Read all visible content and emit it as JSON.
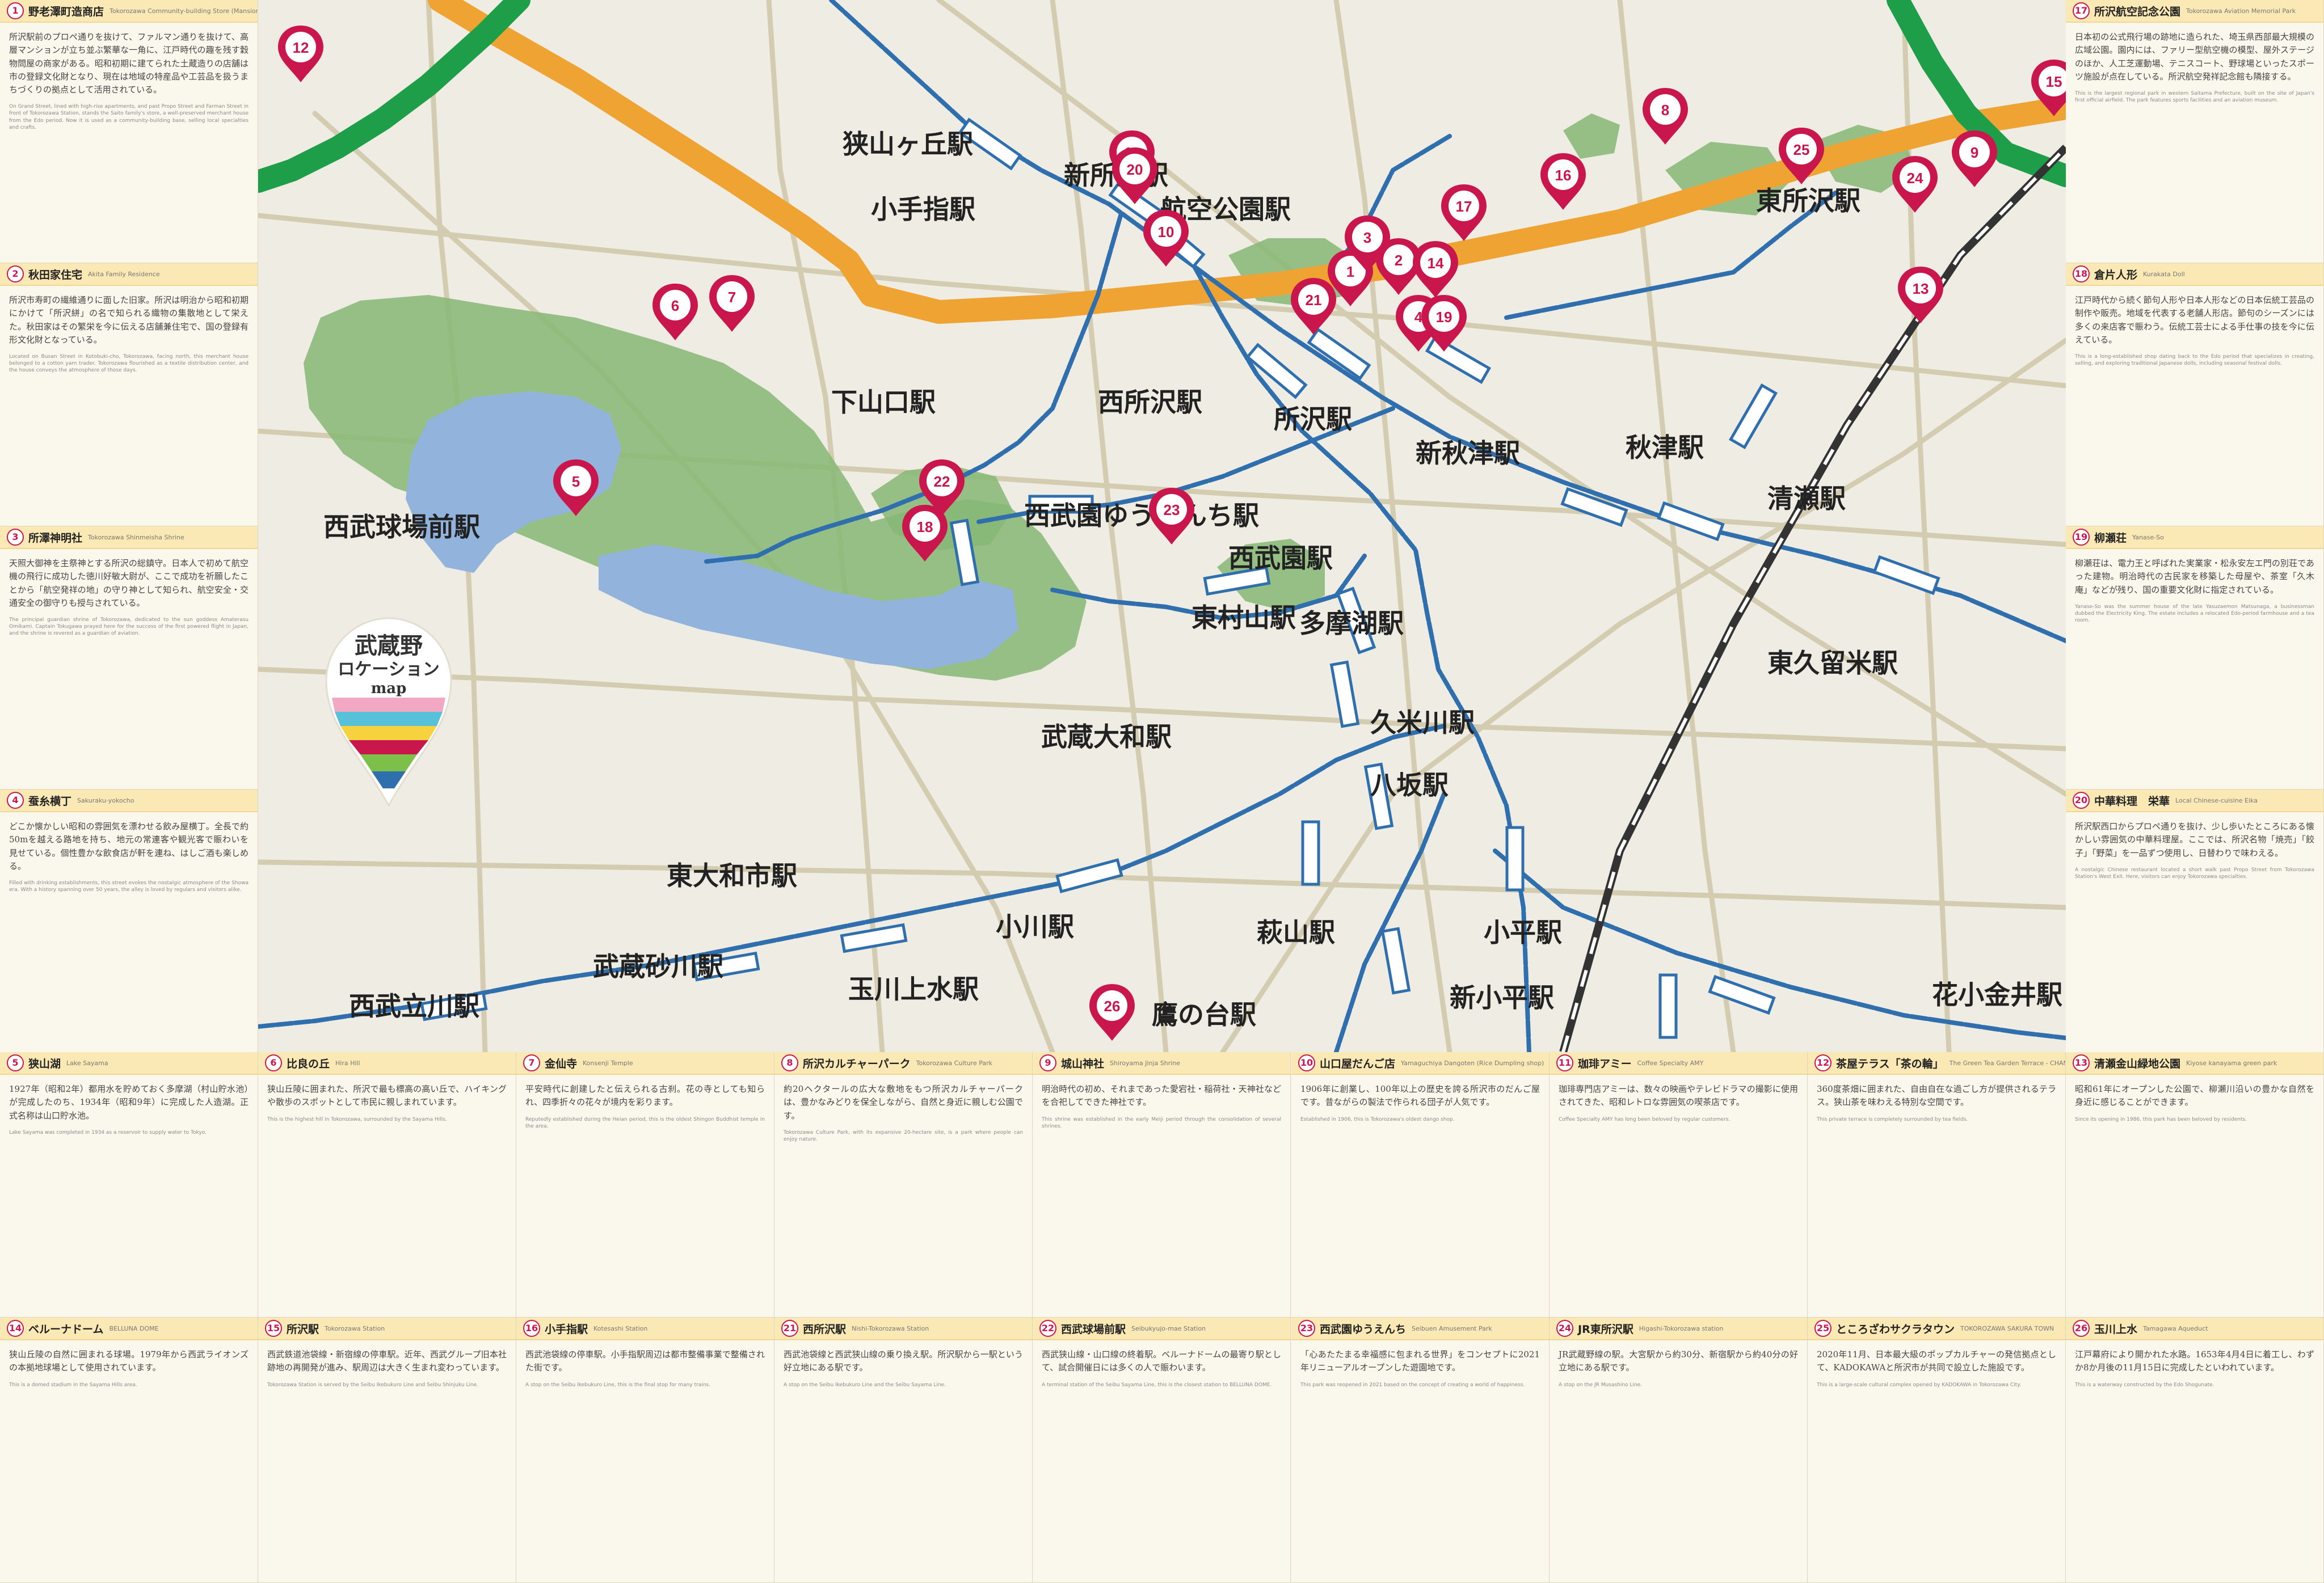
{
  "map": {
    "logo": {
      "line1": "武蔵野",
      "line2": "ロケーション",
      "line3": "map"
    },
    "stations": [
      {
        "label": "狭山ヶ丘駅"
      },
      {
        "label": "新所沢駅"
      },
      {
        "label": "小手指駅"
      },
      {
        "label": "航空公園駅"
      },
      {
        "label": "東所沢駅"
      },
      {
        "label": "下山口駅"
      },
      {
        "label": "西所沢駅"
      },
      {
        "label": "所沢駅"
      },
      {
        "label": "新秋津駅"
      },
      {
        "label": "秋津駅"
      },
      {
        "label": "清瀬駅"
      },
      {
        "label": "西武球場前駅"
      },
      {
        "label": "西武園ゆうえんち駅"
      },
      {
        "label": "西武園駅"
      },
      {
        "label": "多摩湖駅"
      },
      {
        "label": "東村山駅"
      },
      {
        "label": "東久留米駅"
      },
      {
        "label": "武蔵大和駅"
      },
      {
        "label": "久米川駅"
      },
      {
        "label": "八坂駅"
      },
      {
        "label": "東大和市駅"
      },
      {
        "label": "小川駅"
      },
      {
        "label": "萩山駅"
      },
      {
        "label": "小平駅"
      },
      {
        "label": "武蔵砂川駅"
      },
      {
        "label": "西武立川駅"
      },
      {
        "label": "玉川上水駅"
      },
      {
        "label": "新小平駅"
      },
      {
        "label": "鷹の台駅"
      },
      {
        "label": "花小金井駅"
      }
    ],
    "pins": [
      "1",
      "2",
      "3",
      "4",
      "5",
      "6",
      "7",
      "8",
      "9",
      "10",
      "11",
      "12",
      "13",
      "14",
      "15",
      "16",
      "17",
      "18",
      "19",
      "20",
      "21",
      "22",
      "23",
      "24",
      "25",
      "26"
    ]
  },
  "left_panels": [
    {
      "num": "1",
      "title": "野老澤町造商店",
      "en": "Tokorozawa Community-building Store (Mansion)",
      "jp": "所沢駅前のプロペ通りを抜けて、ファルマン通りを抜けて、高層マンションが立ち並ぶ繁華な一角に、江戸時代の趣を残す穀物問屋の商家がある。昭和初期に建てられた土蔵造りの店舗は市の登録文化財となり、現在は地域の特産品や工芸品を扱うまちづくりの拠点として活用されている。",
      "en_body": "On Grand Street, lined with high-rise apartments, and past Propo Street and Farman Street in front of Tokorozawa Station, stands the Saito family's store, a well-preserved merchant house from the Edo period. Now it is used as a community-building base, selling local specialties and crafts."
    },
    {
      "num": "2",
      "title": "秋田家住宅",
      "en": "Akita Family Residence",
      "jp": "所沢市寿町の繊維通りに面した旧家。所沢は明治から昭和初期にかけて「所沢絣」の名で知られる織物の集散地として栄えた。秋田家はその繁栄を今に伝える店舗兼住宅で、国の登録有形文化財となっている。",
      "en_body": "Located on Busan Street in Kotobuki-cho, Tokorozawa, facing north, this merchant house belonged to a cotton yarn trader. Tokorozawa flourished as a textile distribution center, and the house conveys the atmosphere of those days."
    },
    {
      "num": "3",
      "title": "所澤神明社",
      "en": "Tokorozawa Shinmeisha Shrine",
      "jp": "天照大御神を主祭神とする所沢の総鎮守。日本人で初めて航空機の飛行に成功した徳川好敏大尉が、ここで成功を祈願したことから「航空発祥の地」の守り神として知られ、航空安全・交通安全の御守りも授与されている。",
      "en_body": "The principal guardian shrine of Tokorozawa, dedicated to the sun goddess Amaterasu Omikami. Captain Tokugawa prayed here for the success of the first powered flight in Japan, and the shrine is revered as a guardian of aviation."
    },
    {
      "num": "4",
      "title": "蚕糸横丁",
      "en": "Sakuraku-yokocho",
      "jp": "どこか懐かしい昭和の雰囲気を漂わせる飲み屋横丁。全長で約50mを越える路地を持ち、地元の常連客や観光客で賑わいを見せている。個性豊かな飲食店が軒を連ね、はしご酒も楽しめる。",
      "en_body": "Filled with drinking establishments, this street evokes the nostalgic atmosphere of the Showa era. With a history spanning over 50 years, the alley is loved by regulars and visitors alike."
    }
  ],
  "right_panels": [
    {
      "num": "17",
      "title": "所沢航空記念公園",
      "en": "Tokorozawa Aviation Memorial Park",
      "jp": "日本初の公式飛行場の跡地に造られた、埼玉県西部最大規模の広域公園。園内には、ファリー型航空機の模型、屋外ステージのほか、人工芝運動場、テニスコート、野球場といったスポーツ施設が点在している。所沢航空発祥記念館も隣接する。",
      "en_body": "This is the largest regional park in western Saitama Prefecture, built on the site of Japan's first official airfield. The park features sports facilities and an aviation museum."
    },
    {
      "num": "18",
      "title": "倉片人形",
      "en": "Kurakata Doll",
      "jp": "江戸時代から続く節句人形や日本人形などの日本伝統工芸品の制作や販売。地域を代表する老舗人形店。節句のシーズンには多くの来店客で賑わう。伝統工芸士による手仕事の技を今に伝えている。",
      "en_body": "This is a long-established shop dating back to the Edo period that specializes in creating, selling, and exploring traditional Japanese dolls, including seasonal festival dolls."
    },
    {
      "num": "19",
      "title": "柳瀬荘",
      "en": "Yanase-So",
      "jp": "柳瀬荘は、電力王と呼ばれた実業家・松永安左エ門の別荘であった建物。明治時代の古民家を移築した母屋や、茶室「久木庵」などが残り、国の重要文化財に指定されている。",
      "en_body": "Yanase-So was the summer house of the late Yasuzaemon Matsunaga, a businessman dubbed the Electricity King. The estate includes a relocated Edo-period farmhouse and a tea room."
    },
    {
      "num": "20",
      "title": "中華料理　栄華",
      "en": "Local Chinese-cuisine Eika",
      "jp": "所沢駅西口からプロペ通りを抜け、少し歩いたところにある懐かしい雰囲気の中華料理屋。ここでは、所沢名物「焼売」「餃子」「野菜」を一品ずつ使用し、日替わりで味わえる。",
      "en_body": "A nostalgic Chinese restaurant located a short walk past Propo Street from Tokorozawa Station's West Exit. Here, visitors can enjoy Tokorozawa specialties."
    }
  ],
  "bottom_row1": [
    {
      "num": "5",
      "title": "狭山湖",
      "en": "Lake Sayama",
      "jp": "1927年（昭和2年）都用水を貯めておく多摩湖（村山貯水池）が完成したのち、1934年（昭和9年）に完成した人造湖。正式名称は山口貯水池。",
      "en_body": "Lake Sayama was completed in 1934 as a reservoir to supply water to Tokyo."
    },
    {
      "num": "6",
      "title": "比良の丘",
      "en": "Hira Hill",
      "jp": "狭山丘陵に囲まれた、所沢で最も標高の高い丘で、ハイキングや散歩のスポットとして市民に親しまれています。",
      "en_body": "This is the highest hill in Tokorozawa, surrounded by the Sayama Hills."
    },
    {
      "num": "7",
      "title": "金仙寺",
      "en": "Konsenji Temple",
      "jp": "平安時代に創建したと伝えられる古刹。花の寺としても知られ、四季折々の花々が境内を彩ります。",
      "en_body": "Reputedly established during the Heian period, this is the oldest Shingon Buddhist temple in the area."
    },
    {
      "num": "8",
      "title": "所沢カルチャーパーク",
      "en": "Tokorozawa Culture Park",
      "jp": "約20ヘクタールの広大な敷地をもつ所沢カルチャーパークは、豊かなみどりを保全しながら、自然と身近に親しむ公園です。",
      "en_body": "Tokorozawa Culture Park, with its expansive 20-hectare site, is a park where people can enjoy nature."
    },
    {
      "num": "9",
      "title": "城山神社",
      "en": "Shiroyama Jinja Shrine",
      "jp": "明治時代の初め、それまであった愛宕社・稲荷社・天神社などを合祀してできた神社です。",
      "en_body": "This shrine was established in the early Meiji period through the consolidation of several shrines."
    },
    {
      "num": "10",
      "title": "山口屋だんご店",
      "en": "Yamaguchiya Dangoten (Rice Dumpling shop)",
      "jp": "1906年に創業し、100年以上の歴史を誇る所沢市のだんご屋です。昔ながらの製法で作られる団子が人気です。",
      "en_body": "Established in 1906, this is Tokorozawa's oldest dango shop."
    },
    {
      "num": "11",
      "title": "珈琲アミー",
      "en": "Coffee Specialty AMY",
      "jp": "珈琲専門店アミーは、数々の映画やテレビドラマの撮影に使用されてきた、昭和レトロな雰囲気の喫茶店です。",
      "en_body": "Coffee Specialty AMY has long been beloved by regular customers."
    },
    {
      "num": "12",
      "title": "茶屋テラス「茶の輪」",
      "en": "The Green Tea Garden Terrace - CHANOWA",
      "jp": "360度茶畑に囲まれた、自由自在な過ごし方が提供されるテラス。狭山茶を味わえる特別な空間です。",
      "en_body": "This private terrace is completely surrounded by tea fields."
    },
    {
      "num": "13",
      "title": "清瀬金山緑地公園",
      "en": "Kiyose kanayama green park",
      "jp": "昭和61年にオープンした公園で、柳瀬川沿いの豊かな自然を身近に感じることができます。",
      "en_body": "Since its opening in 1986, this park has been beloved by residents."
    }
  ],
  "bottom_row2": [
    {
      "num": "14",
      "title": "ベルーナドーム",
      "en": "BELLUNA DOME",
      "jp": "狭山丘陵の自然に囲まれる球場。1979年から西武ライオンズの本拠地球場として使用されています。",
      "en_body": "This is a domed stadium in the Sayama Hills area."
    },
    {
      "num": "15",
      "title": "所沢駅",
      "en": "Tokorozawa Station",
      "jp": "西武鉄道池袋線・新宿線の停車駅。近年、西武グループ旧本社跡地の再開発が進み、駅周辺は大きく生まれ変わっています。",
      "en_body": "Tokorozawa Station is served by the Seibu Ikebukuro Line and Seibu Shinjuku Line."
    },
    {
      "num": "16",
      "title": "小手指駅",
      "en": "Kotesashi Station",
      "jp": "西武池袋線の停車駅。小手指駅周辺は都市整備事業で整備された街です。",
      "en_body": "A stop on the Seibu Ikebukuro Line, this is the final stop for many trains."
    },
    {
      "num": "21",
      "title": "西所沢駅",
      "en": "Nishi-Tokorozawa Station",
      "jp": "西武池袋線と西武狭山線の乗り換え駅。所沢駅から一駅という好立地にある駅です。",
      "en_body": "A stop on the Seibu Ikebukuro Line and the Seibu Sayama Line."
    },
    {
      "num": "22",
      "title": "西武球場前駅",
      "en": "Seibukyujo-mae Station",
      "jp": "西武狭山線・山口線の終着駅。ベルーナドームの最寄り駅として、試合開催日には多くの人で賑わいます。",
      "en_body": "A terminal station of the Seibu Sayama Line, this is the closest station to BELLUNA DOME."
    },
    {
      "num": "23",
      "title": "西武園ゆうえんち",
      "en": "Seibuen Amusement Park",
      "jp": "「心あたたまる幸福感に包まれる世界」をコンセプトに2021年リニューアルオープンした遊園地です。",
      "en_body": "This park was reopened in 2021 based on the concept of creating a world of happiness."
    },
    {
      "num": "24",
      "title": "JR東所沢駅",
      "en": "Higashi-Tokorozawa station",
      "jp": "JR武蔵野線の駅。大宮駅から約30分、新宿駅から約40分の好立地にある駅です。",
      "en_body": "A stop on the JR Musashino Line."
    },
    {
      "num": "25",
      "title": "ところざわサクラタウン",
      "en": "TOKOROZAWA SAKURA TOWN",
      "jp": "2020年11月、日本最大級のポップカルチャーの発信拠点として、KADOKAWAと所沢市が共同で設立した施設です。",
      "en_body": "This is a large-scale cultural complex opened by KADOKAWA in Tokorozawa City."
    },
    {
      "num": "26",
      "title": "玉川上水",
      "en": "Tamagawa Aqueduct",
      "jp": "江戸幕府により開かれた水路。1653年4月4日に着工し、わずか8か月後の11月15日に完成したといわれています。",
      "en_body": "This is a waterway constructed by the Edo Shogunate."
    }
  ]
}
